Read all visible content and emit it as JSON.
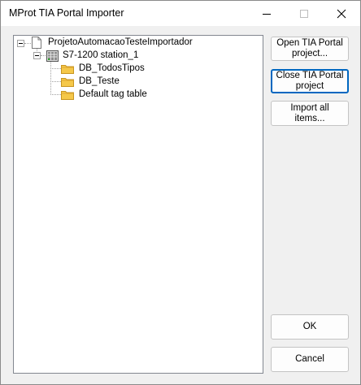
{
  "window": {
    "title": "MProt TIA Portal Importer"
  },
  "tree": {
    "root": {
      "label": "ProjetoAutomacaoTesteImportador",
      "icon": "document-icon",
      "expanded": true
    },
    "station": {
      "label": "S7-1200 station_1",
      "icon": "plc-icon",
      "expanded": true
    },
    "items": [
      {
        "label": "DB_TodosTipos",
        "icon": "folder-icon"
      },
      {
        "label": "DB_Teste",
        "icon": "folder-icon"
      },
      {
        "label": "Default tag table",
        "icon": "folder-icon"
      }
    ]
  },
  "buttons": {
    "open_project": "Open TIA Portal project...",
    "close_project": "Close TIA Portal project",
    "import_all": "Import all items...",
    "ok": "OK",
    "cancel": "Cancel"
  },
  "colors": {
    "focus_border": "#0067c0",
    "folder_fill": "#f5c84a",
    "folder_border": "#c89520"
  }
}
